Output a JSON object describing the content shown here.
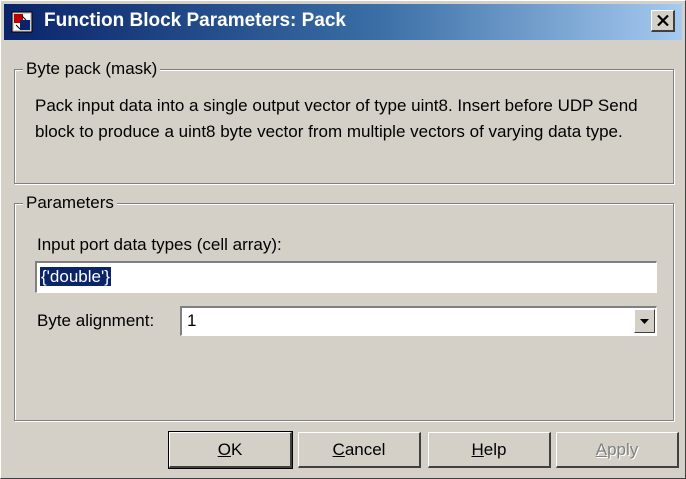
{
  "window": {
    "title": "Function Block Parameters: Pack",
    "close_label": "×"
  },
  "description_group": {
    "legend": "Byte pack (mask)",
    "text": "Pack input data into a single output vector of type uint8. Insert before UDP Send block to produce a uint8 byte vector from multiple vectors of varying data type."
  },
  "parameters_group": {
    "legend": "Parameters",
    "input_types_label": "Input port data types (cell array):",
    "input_types_value": "{'double'}",
    "byte_alignment_label": "Byte alignment:",
    "byte_alignment_value": "1"
  },
  "buttons": {
    "ok": {
      "mnemonic": "O",
      "rest": "K"
    },
    "cancel": {
      "mnemonic": "C",
      "rest": "ancel"
    },
    "help": {
      "mnemonic": "H",
      "rest": "elp"
    },
    "apply": {
      "mnemonic": "A",
      "rest": "pply"
    }
  },
  "icons": {
    "title_icon": "simulink-block-icon",
    "close": "close-icon",
    "dropdown": "chevron-down-icon"
  },
  "colors": {
    "title_gradient_start": "#0a246a",
    "title_gradient_end": "#a6caf0",
    "selection": "#0a246a",
    "face": "#d4d0c8"
  }
}
